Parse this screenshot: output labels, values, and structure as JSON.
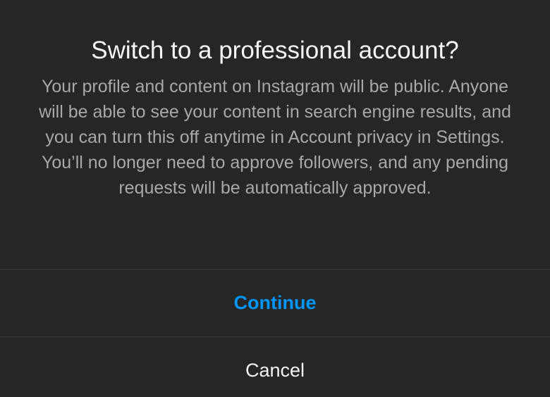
{
  "dialog": {
    "title": "Switch to a professional account?",
    "message": "Your profile and content on Instagram will be public. Anyone will be able to see your content in search engine results, and you can turn this off anytime in Account privacy in Settings. You’ll no longer need to approve followers, and any pending requests will be automatically approved.",
    "continue_label": "Continue",
    "cancel_label": "Cancel"
  },
  "colors": {
    "background": "#262626",
    "title": "#f5f5f5",
    "message": "#a8a8a8",
    "accent": "#0095f6",
    "divider": "#3d3d3d"
  }
}
